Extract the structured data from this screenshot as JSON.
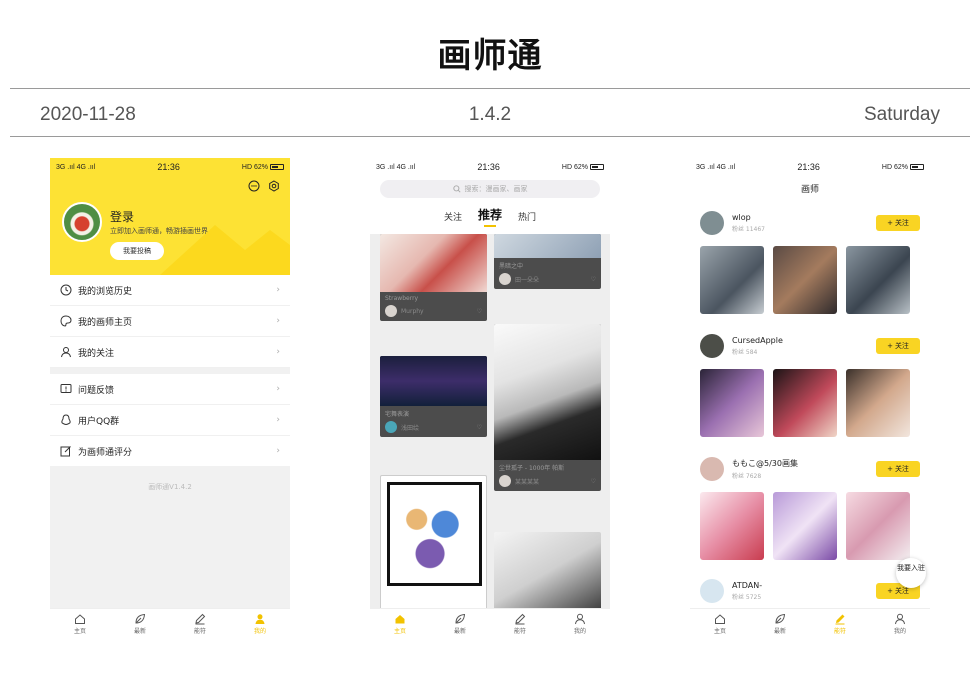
{
  "header": {
    "title": "画师通",
    "date": "2020-11-28",
    "version": "1.4.2",
    "weekday": "Saturday"
  },
  "status": {
    "left": "3G .ııl 4G .ııl",
    "time": "21:36",
    "right": "HD 62%"
  },
  "tabbar": {
    "home": "主页",
    "latest": "最新",
    "commission": "能符",
    "mine": "我的"
  },
  "phone1": {
    "login": "登录",
    "login_sub": "立即加入画师通，畅游插画世界",
    "post_button": "我要投稿",
    "menu": [
      {
        "label": "我的浏览历史",
        "icon": "clock-icon"
      },
      {
        "label": "我的画师主页",
        "icon": "palette-icon"
      },
      {
        "label": "我的关注",
        "icon": "user-icon"
      },
      {
        "label": "问题反馈",
        "icon": "feedback-icon"
      },
      {
        "label": "用户QQ群",
        "icon": "qq-icon"
      },
      {
        "label": "为画师通评分",
        "icon": "edit-icon"
      }
    ],
    "version_text": "画师通V1.4.2"
  },
  "phone2": {
    "search_placeholder": "搜索：漫画家、画家",
    "tabs": [
      "关注",
      "推荐",
      "热门"
    ],
    "cards": [
      {
        "title": "Strawberry",
        "user": "Murphy"
      },
      {
        "title": "黑暗之中",
        "user": "田一朵朵"
      },
      {
        "title": "宅舞表演",
        "user": "浅田绘"
      },
      {
        "title": "尘世孤子 - 1000年 帕斯",
        "user": "某某某某"
      }
    ]
  },
  "phone3": {
    "title": "画师",
    "artists": [
      {
        "name": "wlop",
        "fans": "粉丝 11467"
      },
      {
        "name": "CursedApple",
        "fans": "粉丝 584"
      },
      {
        "name": "ももこ@5/30画集",
        "fans": "粉丝 7628"
      },
      {
        "name": "ATDAN-",
        "fans": "粉丝 5725"
      }
    ],
    "follow_label": "关注",
    "join_button": "我要入驻"
  },
  "colors": {
    "accent": "#fde234",
    "follow": "#f9d423"
  }
}
